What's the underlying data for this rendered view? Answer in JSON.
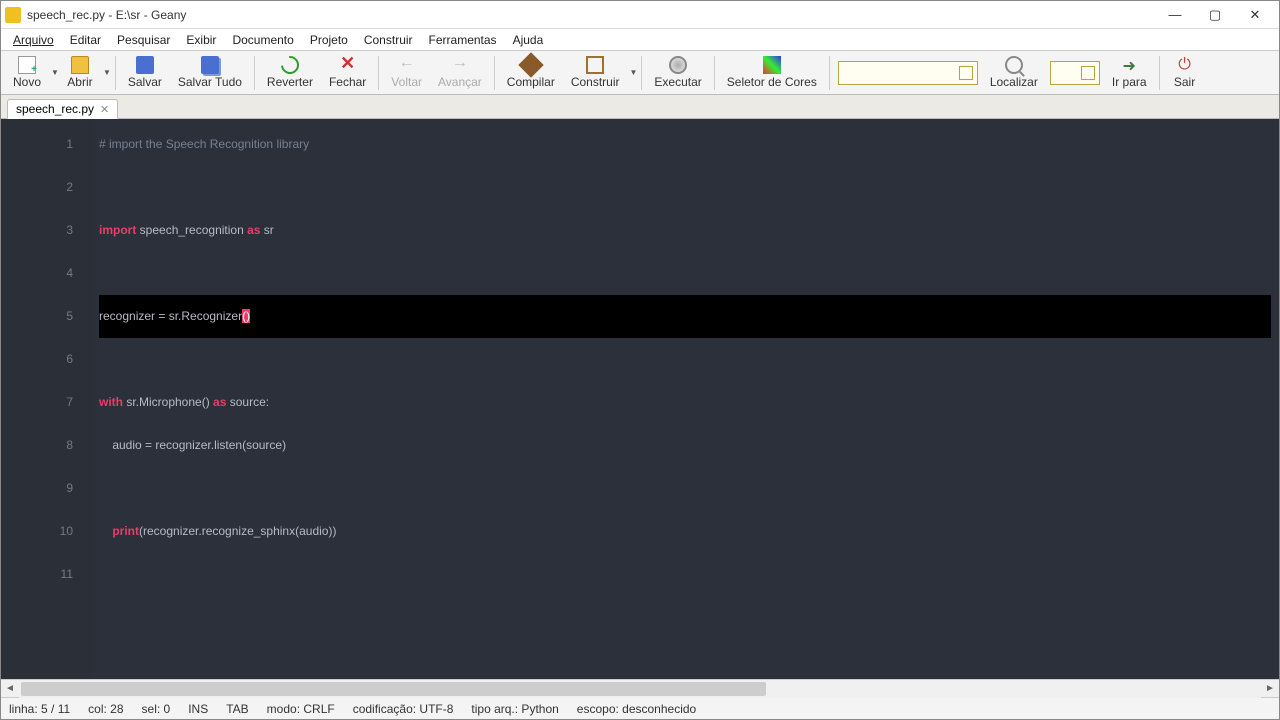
{
  "window": {
    "title": "speech_rec.py - E:\\sr - Geany"
  },
  "menu": {
    "items": [
      "Arquivo",
      "Editar",
      "Pesquisar",
      "Exibir",
      "Documento",
      "Projeto",
      "Construir",
      "Ferramentas",
      "Ajuda"
    ]
  },
  "toolbar": {
    "novo": "Novo",
    "abrir": "Abrir",
    "salvar": "Salvar",
    "salvar_tudo": "Salvar Tudo",
    "reverter": "Reverter",
    "fechar": "Fechar",
    "voltar": "Voltar",
    "avancar": "Avançar",
    "compilar": "Compilar",
    "construir": "Construir",
    "executar": "Executar",
    "seletor_cores": "Seletor de Cores",
    "localizar": "Localizar",
    "ir_para": "Ir para",
    "sair": "Sair"
  },
  "tabs": {
    "active": "speech_rec.py"
  },
  "code": {
    "lines": [
      {
        "n": "1",
        "tok": [
          [
            "cm",
            "# import the Speech Recognition library"
          ]
        ]
      },
      {
        "n": "2",
        "tok": []
      },
      {
        "n": "3",
        "tok": [
          [
            "kw",
            "import"
          ],
          [
            "",
            " speech_recognition "
          ],
          [
            "kw",
            "as"
          ],
          [
            "",
            " sr"
          ]
        ]
      },
      {
        "n": "4",
        "tok": []
      },
      {
        "n": "5",
        "selected": true,
        "tok": [
          [
            "",
            "recognizer = sr.Recognizer"
          ],
          [
            "hl-paren",
            "()"
          ]
        ]
      },
      {
        "n": "6",
        "tok": []
      },
      {
        "n": "7",
        "tok": [
          [
            "kw",
            "with"
          ],
          [
            "",
            " sr.Microphone() "
          ],
          [
            "kw",
            "as"
          ],
          [
            "",
            " source:"
          ]
        ]
      },
      {
        "n": "8",
        "tok": [
          [
            "",
            "    audio = recognizer.listen(source)"
          ]
        ]
      },
      {
        "n": "9",
        "tok": []
      },
      {
        "n": "10",
        "tok": [
          [
            "",
            "    "
          ],
          [
            "fn",
            "print"
          ],
          [
            "",
            "(recognizer.recognize_sphinx(audio))"
          ]
        ]
      },
      {
        "n": "11",
        "tok": []
      }
    ]
  },
  "status": {
    "pos": "linha: 5 / 11",
    "col": "col: 28",
    "sel": "sel: 0",
    "ins": "INS",
    "tab": "TAB",
    "mode": "modo: CRLF",
    "enc": "codificação: UTF-8",
    "type": "tipo arq.: Python",
    "scope": "escopo: desconhecido"
  }
}
